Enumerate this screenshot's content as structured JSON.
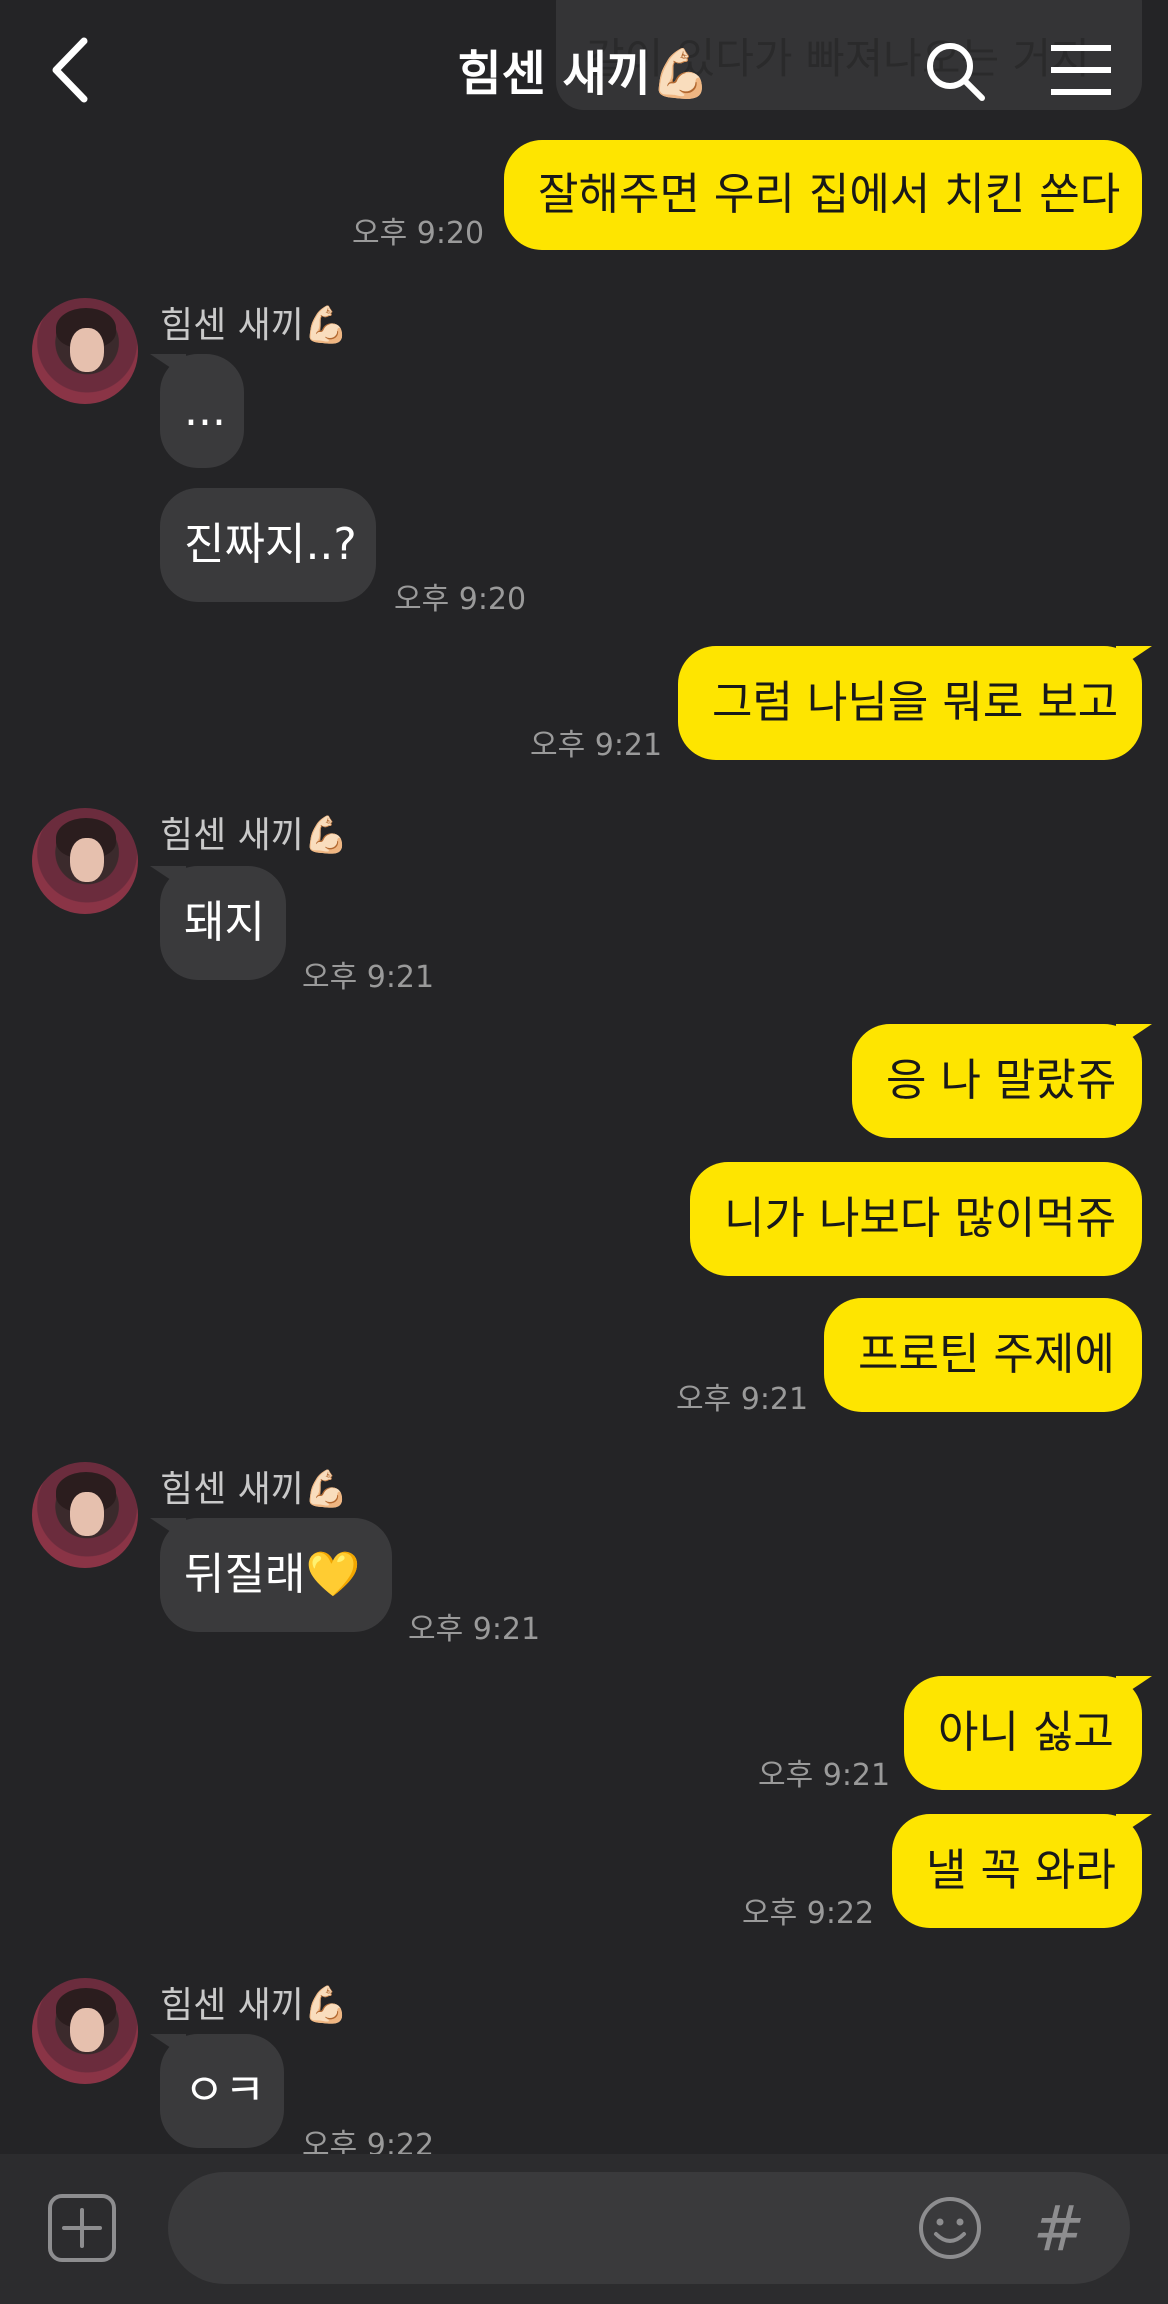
{
  "header": {
    "title": "힘센 새끼💪🏻",
    "partial_top_message": "같이 있다가 빠져나오는 거지"
  },
  "contact": {
    "name": "힘센 새끼💪🏻"
  },
  "messages": {
    "m1": {
      "text": "잘해주면 우리 집에서 치킨 쏜다",
      "time": "오후 9:20"
    },
    "m2": {
      "text": "..."
    },
    "m3": {
      "text": "진짜지..?",
      "time": "오후 9:20"
    },
    "m4": {
      "text": "그럼 나님을 뭐로 보고",
      "time": "오후 9:21"
    },
    "m5": {
      "text": "돼지",
      "time": "오후 9:21"
    },
    "m6": {
      "text": "응 나 말랐쥬"
    },
    "m7": {
      "text": "니가 나보다 많이먹쥬"
    },
    "m8": {
      "text": "프로틴 주제에",
      "time": "오후 9:21"
    },
    "m9": {
      "text": "뒤질래💛",
      "time": "오후 9:21"
    },
    "m10": {
      "text": "아니 싫고",
      "time": "오후 9:21"
    },
    "m11": {
      "text": "낼 꼭 와라",
      "time": "오후 9:22"
    },
    "m12": {
      "text": "ㅇㅋ",
      "time": "오후 9:22"
    }
  },
  "input": {
    "placeholder": "",
    "hash_symbol": "#"
  },
  "colors": {
    "background": "#242426",
    "outgoing_bubble": "#fee500",
    "incoming_bubble": "#3a3a3c"
  },
  "icons": [
    "back-icon",
    "search-icon",
    "menu-icon",
    "plus-icon",
    "emoji-icon",
    "hashtag-icon"
  ]
}
